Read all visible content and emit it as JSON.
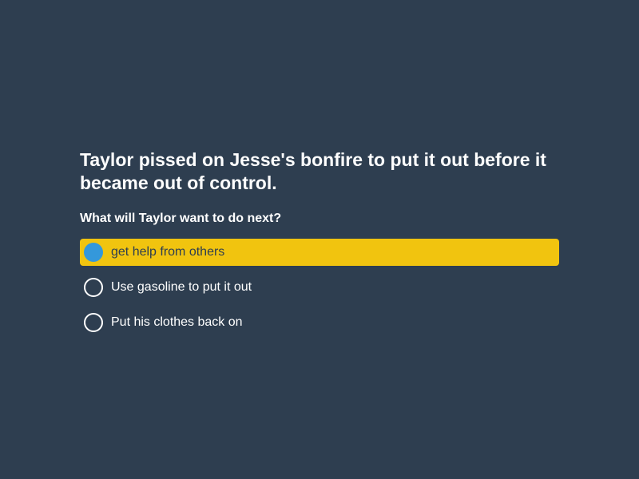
{
  "prompt": "Taylor pissed on Jesse's bonfire to put it out before it became out of control.",
  "question": "What will Taylor want to do next?",
  "options": [
    {
      "label": "get help from others",
      "selected": true
    },
    {
      "label": "Use gasoline to put it out",
      "selected": false
    },
    {
      "label": "Put his clothes back on",
      "selected": false
    }
  ],
  "colors": {
    "background": "#2e3e50",
    "selected_highlight": "#f1c40f",
    "selected_radio": "#3498db",
    "text": "#ffffff"
  }
}
